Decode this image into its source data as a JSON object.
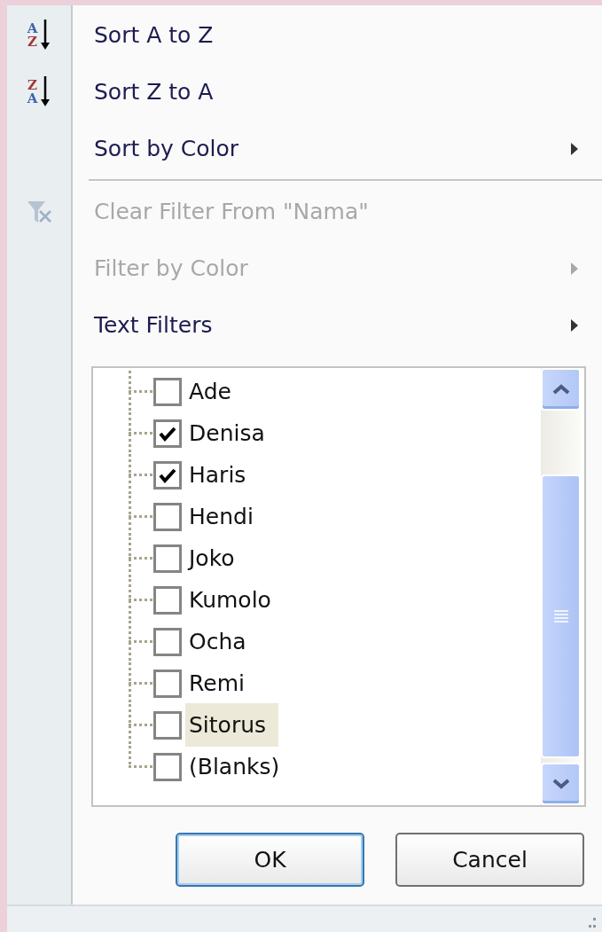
{
  "menu_sections": [
    [
      {
        "kind": "sort",
        "label": "Sort A to Z",
        "icon_letters": [
          "A",
          "Z"
        ],
        "disabled": false
      },
      {
        "kind": "sort",
        "label": "Sort Z to A",
        "icon_letters": [
          "Z",
          "A"
        ],
        "disabled": false
      },
      {
        "kind": "submenu",
        "label": "Sort by Color",
        "disabled": false
      }
    ],
    [
      {
        "kind": "clear_filter",
        "label": "Clear Filter From \"Nama\"",
        "disabled": true
      },
      {
        "kind": "submenu",
        "label": "Filter by Color",
        "disabled": true
      },
      {
        "kind": "submenu",
        "label": "Text Filters",
        "disabled": false
      }
    ]
  ],
  "filter_list": {
    "items": [
      {
        "label": "Ade",
        "checked": false,
        "hovered": false
      },
      {
        "label": "Denisa",
        "checked": true,
        "hovered": false
      },
      {
        "label": "Haris",
        "checked": true,
        "hovered": false
      },
      {
        "label": "Hendi",
        "checked": false,
        "hovered": false
      },
      {
        "label": "Joko",
        "checked": false,
        "hovered": false
      },
      {
        "label": "Kumolo",
        "checked": false,
        "hovered": false
      },
      {
        "label": "Ocha",
        "checked": false,
        "hovered": false
      },
      {
        "label": "Remi",
        "checked": false,
        "hovered": false
      },
      {
        "label": "Sitorus",
        "checked": false,
        "hovered": true
      },
      {
        "label": "(Blanks)",
        "checked": false,
        "hovered": false
      }
    ]
  },
  "buttons": [
    {
      "label": "OK",
      "default": true
    },
    {
      "label": "Cancel",
      "default": false
    }
  ]
}
